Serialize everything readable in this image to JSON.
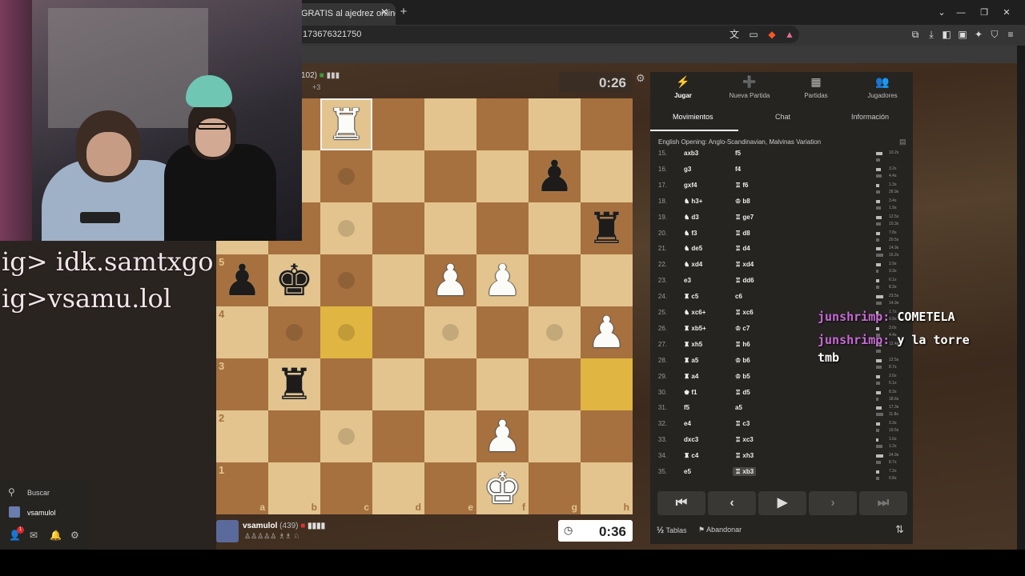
{
  "browser": {
    "tab_title": "GRATIS al ajedrez online -",
    "url": "173676321750",
    "close_symbol": "✕",
    "new_tab_symbol": "+",
    "window_min": "—",
    "window_max": "❐",
    "window_close": "✕",
    "window_menu": "⌄"
  },
  "overlay": {
    "ig1": "ig> idk.samtxgo",
    "ig2": "ig>vsamu.lol"
  },
  "board": {
    "ranks": [
      "8",
      "7",
      "6",
      "5",
      "4",
      "3",
      "2",
      "1"
    ],
    "files": [
      "a",
      "b",
      "c",
      "d",
      "e",
      "f",
      "g",
      "h"
    ],
    "pieces": [
      {
        "sq": "c8",
        "glyph": "♜",
        "color": "w"
      },
      {
        "sq": "g7",
        "glyph": "♟",
        "color": "b"
      },
      {
        "sq": "h6",
        "glyph": "♜",
        "color": "b"
      },
      {
        "sq": "a5",
        "glyph": "♟",
        "color": "b"
      },
      {
        "sq": "b5",
        "glyph": "♚",
        "color": "b"
      },
      {
        "sq": "e5",
        "glyph": "♟",
        "color": "w"
      },
      {
        "sq": "f5",
        "glyph": "♟",
        "color": "w"
      },
      {
        "sq": "h4",
        "glyph": "♟",
        "color": "w"
      },
      {
        "sq": "b3",
        "glyph": "♜",
        "color": "b"
      },
      {
        "sq": "f2",
        "glyph": "♟",
        "color": "w"
      },
      {
        "sq": "f1",
        "glyph": "♚",
        "color": "w"
      }
    ],
    "highlights": [
      "c4",
      "h3"
    ],
    "selected": "c8",
    "dots": [
      "c6",
      "c5",
      "b4",
      "c4",
      "e4",
      "g4",
      "c2",
      "c7",
      "c8"
    ]
  },
  "top_player": {
    "rating": "102)",
    "extra": "+3",
    "clock": "0:26",
    "settings_icon": "gear-icon"
  },
  "bottom_player": {
    "name": "vsamulol",
    "rating": "(439)",
    "material": "♙♙♙♙♙ ♗♗ ♘",
    "clock": "0:36"
  },
  "sidebar": {
    "nav": [
      {
        "label": "Jugar",
        "icon": "⚡",
        "name": "play"
      },
      {
        "label": "Nueva Partida",
        "icon": "➕",
        "name": "new-game"
      },
      {
        "label": "Partidas",
        "icon": "▦",
        "name": "games"
      },
      {
        "label": "Jugadores",
        "icon": "👥",
        "name": "players"
      }
    ],
    "tabs": [
      "Movimientos",
      "Chat",
      "Información"
    ],
    "opening": "English Opening: Anglo-Scandinavian, Malvinas Variation",
    "moves": [
      {
        "n": "15.",
        "w": "axb3",
        "b": "f5",
        "t1": "10.2s",
        "t2": ""
      },
      {
        "n": "16.",
        "w": "g3",
        "b": "f4",
        "t1": "3.2s",
        "t2": "4.4s"
      },
      {
        "n": "17.",
        "w": "gxf4",
        "b": "♖ f6",
        "t1": "1.3s",
        "t2": "26.9s"
      },
      {
        "n": "18.",
        "w": "♞ h3+",
        "b": "♔ b8",
        "t1": "3.4s",
        "t2": "1.9s"
      },
      {
        "n": "19.",
        "w": "♞ d3",
        "b": "♖ ge7",
        "t1": "12.5s",
        "t2": "10.3s"
      },
      {
        "n": "20.",
        "w": "♞ f3",
        "b": "♖ d8",
        "t1": "7.8s",
        "t2": "20.5s"
      },
      {
        "n": "21.",
        "w": "♞ de5",
        "b": "♖ d4",
        "t1": "14.9s",
        "t2": "16.2s"
      },
      {
        "n": "22.",
        "w": "♞ xd4",
        "b": "♖ xd4",
        "t1": "2.9s",
        "t2": "3.3s"
      },
      {
        "n": "23.",
        "w": "e3",
        "b": "♖ dd6",
        "t1": "6.1s",
        "t2": "8.3s"
      },
      {
        "n": "24.",
        "w": "♜ c5",
        "b": "c6",
        "t1": "23.5s",
        "t2": "14.9s"
      },
      {
        "n": "25.",
        "w": "♞ xc6+",
        "b": "♖ xc6",
        "t1": "1.7s",
        "t2": "0.9s"
      },
      {
        "n": "26.",
        "w": "♜ xb5+",
        "b": "♔ c7",
        "t1": "3.0s",
        "t2": "4.4s"
      },
      {
        "n": "27.",
        "w": "♜ xh5",
        "b": "♖ h6",
        "t1": "12.4s",
        "t2": ""
      },
      {
        "n": "28.",
        "w": "♜ a5",
        "b": "♔ b6",
        "t1": "12.5s",
        "t2": "8.7s"
      },
      {
        "n": "29.",
        "w": "♜ a4",
        "b": "♔ b5",
        "t1": "2.6s",
        "t2": "5.1s"
      },
      {
        "n": "30.",
        "w": "♚ f1",
        "b": "♖ d5",
        "t1": "8.3s",
        "t2": "18.6s"
      },
      {
        "n": "31.",
        "w": "f5",
        "b": "a5",
        "t1": "17.3s",
        "t2": "11.8s"
      },
      {
        "n": "32.",
        "w": "e4",
        "b": "♖ c3",
        "t1": "3.3s",
        "t2": "19.5s"
      },
      {
        "n": "33.",
        "w": "dxc3",
        "b": "♖ xc3",
        "t1": "1.6s",
        "t2": "1.2s"
      },
      {
        "n": "34.",
        "w": "♜ c4",
        "b": "♖ xh3",
        "t1": "24.9s",
        "t2": "8.7s"
      },
      {
        "n": "35.",
        "w": "e5",
        "b": "♖ xb3",
        "t1": "7.2s",
        "t2": "0.8s"
      }
    ],
    "controls": [
      "⏮",
      "‹",
      "▶",
      "›",
      "⏭"
    ],
    "draw_label": "Tablas",
    "draw_prefix": "½",
    "resign_label": "Abandonar",
    "flip_icon": "⇅"
  },
  "chat_overlay": [
    {
      "user": "junshrimp:",
      "msg": "COMETELA"
    },
    {
      "user": "junshrimp:",
      "msg": "y la torre",
      "cont": "tmb"
    }
  ],
  "left_panel": {
    "search": "Buscar",
    "username": "vsamulol",
    "badge": "1"
  }
}
